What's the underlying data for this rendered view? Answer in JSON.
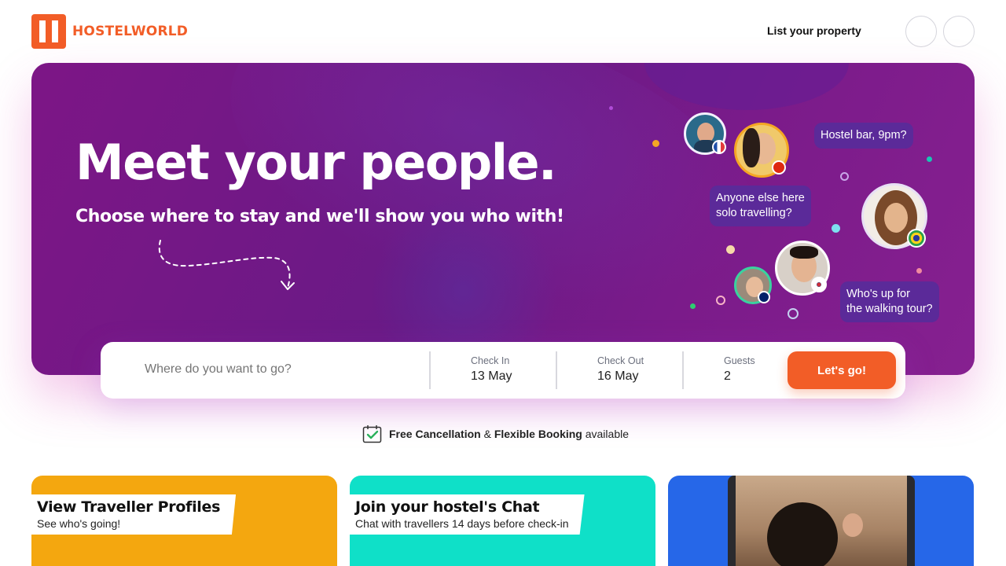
{
  "brand": {
    "name": "HOSTELWORLD",
    "color": "#f25d27"
  },
  "header": {
    "list_property": "List your property",
    "icons": [
      "account-circle-icon",
      "menu-circle-icon"
    ]
  },
  "hero": {
    "title": "Meet your people.",
    "subtitle": "Choose where to stay and we'll show you who with!",
    "bubbles": {
      "bar": "Hostel bar, 9pm?",
      "solo_line1": "Anyone else here",
      "solo_line2": "solo travelling?",
      "tour_line1": "Who's up for",
      "tour_line2": "the walking tour?"
    },
    "flags": [
      "france-flag",
      "china-flag",
      "brazil-flag",
      "south-korea-flag",
      "australia-flag"
    ]
  },
  "search": {
    "placeholder": "Where do you want to go?",
    "check_in": {
      "label": "Check In",
      "value": "13 May"
    },
    "check_out": {
      "label": "Check Out",
      "value": "16 May"
    },
    "guests": {
      "label": "Guests",
      "value": "2"
    },
    "submit": "Let's go!"
  },
  "cancellation": {
    "part1": "Free Cancellation",
    "amp": " & ",
    "part2": "Flexible Booking",
    "part3": " available"
  },
  "cards": [
    {
      "title": "View Traveller Profiles",
      "subtitle": "See who's going!",
      "color": "#f4a70f"
    },
    {
      "title": "Join your hostel's Chat",
      "subtitle": "Chat with travellers 14 days before check-in",
      "color": "#0fe0c8"
    },
    {
      "title": "",
      "subtitle": "",
      "color": "#2667e8"
    }
  ]
}
